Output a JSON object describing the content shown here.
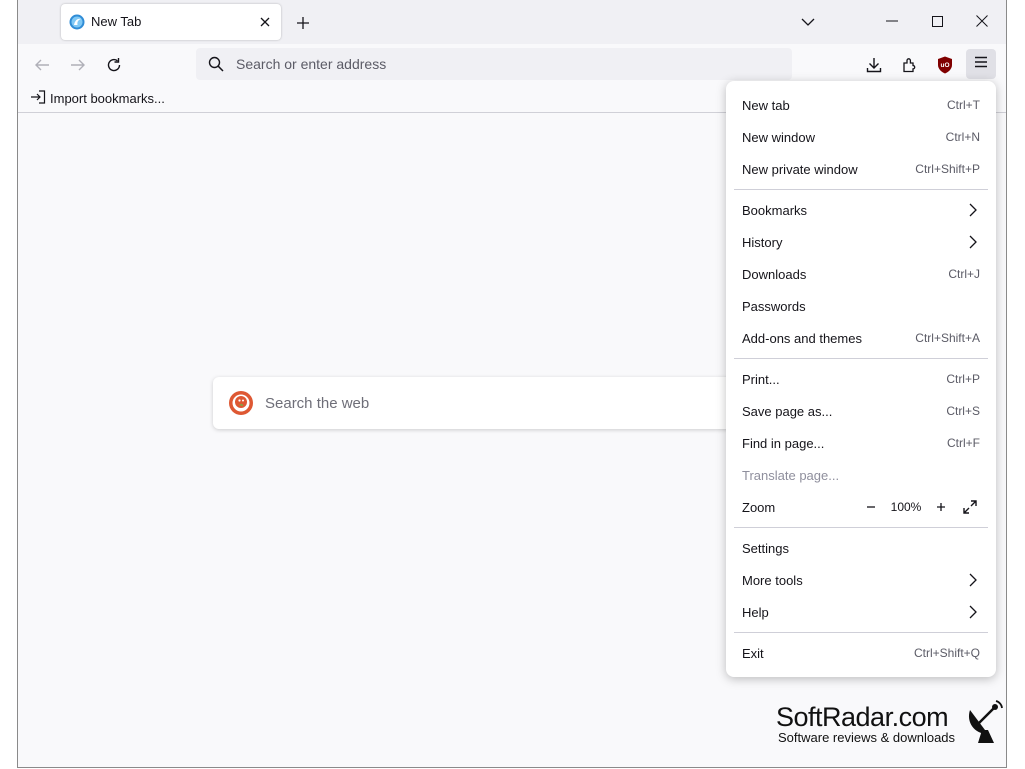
{
  "tab": {
    "title": "New Tab"
  },
  "urlbar": {
    "placeholder": "Search or enter address"
  },
  "bookmarks_toolbar": {
    "import_label": "Import bookmarks..."
  },
  "content": {
    "search_placeholder": "Search the web"
  },
  "app_menu": {
    "items": [
      {
        "label": "New tab",
        "shortcut": "Ctrl+T"
      },
      {
        "label": "New window",
        "shortcut": "Ctrl+N"
      },
      {
        "label": "New private window",
        "shortcut": "Ctrl+Shift+P"
      },
      {
        "label": "Bookmarks"
      },
      {
        "label": "History"
      },
      {
        "label": "Downloads",
        "shortcut": "Ctrl+J"
      },
      {
        "label": "Passwords"
      },
      {
        "label": "Add-ons and themes",
        "shortcut": "Ctrl+Shift+A"
      },
      {
        "label": "Print...",
        "shortcut": "Ctrl+P"
      },
      {
        "label": "Save page as...",
        "shortcut": "Ctrl+S"
      },
      {
        "label": "Find in page...",
        "shortcut": "Ctrl+F"
      },
      {
        "label": "Translate page..."
      },
      {
        "label": "Zoom"
      },
      {
        "label": "Settings"
      },
      {
        "label": "More tools"
      },
      {
        "label": "Help"
      },
      {
        "label": "Exit",
        "shortcut": "Ctrl+Shift+Q"
      }
    ],
    "zoom_level": "100%"
  },
  "watermark": {
    "name": "SoftRadar.com",
    "tagline": "Software reviews & downloads"
  },
  "colors": {
    "accent": "#0061e0",
    "ublock": "#800000",
    "duckduckgo": "#de5833"
  },
  "icons": [
    "firefox-icon",
    "close-icon",
    "plus-icon",
    "chevron-down-icon",
    "minimize-icon",
    "maximize-icon",
    "back-icon",
    "forward-icon",
    "reload-icon",
    "search-icon",
    "download-icon",
    "extensions-icon",
    "ublock-icon",
    "hamburger-menu-icon",
    "import-icon",
    "duckduckgo-icon",
    "chevron-right-icon",
    "zoom-out-icon",
    "zoom-in-icon",
    "fullscreen-icon",
    "satellite-dish-icon"
  ]
}
